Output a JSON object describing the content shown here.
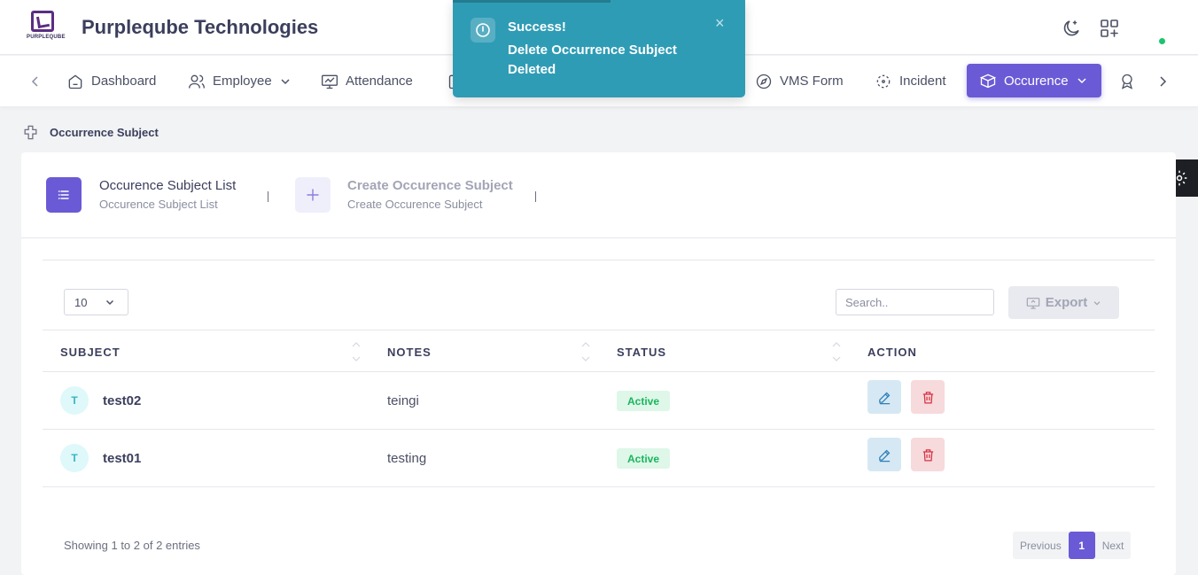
{
  "header": {
    "logo_text": "PURPLEQUBE",
    "company_name": "Purpleqube Technologies"
  },
  "toast": {
    "title": "Success!",
    "message": "Delete Occurrence Subject Deleted",
    "close": "×"
  },
  "nav": {
    "items": [
      {
        "label": "Dashboard",
        "icon": "home-icon"
      },
      {
        "label": "Employee",
        "icon": "users-icon"
      },
      {
        "label": "Attendance",
        "icon": "monitor-chart-icon"
      },
      {
        "label": "VMS Form",
        "icon": "compass-icon"
      },
      {
        "label": "Incident",
        "icon": "focus-icon"
      }
    ],
    "active": {
      "label": "Occurence",
      "icon": "box-icon"
    }
  },
  "breadcrumb": {
    "label": "Occurrence Subject"
  },
  "tabs": [
    {
      "title": "Occurence Subject List",
      "subtitle": "Occurence Subject List",
      "icon": "list-icon"
    },
    {
      "title": "Create Occurence Subject",
      "subtitle": "Create Occurence Subject",
      "icon": "plus-icon"
    }
  ],
  "table": {
    "page_length": "10",
    "search_placeholder": "Search..",
    "export_label": "Export",
    "columns": [
      "SUBJECT",
      "NOTES",
      "STATUS",
      "ACTION"
    ],
    "rows": [
      {
        "initial": "T",
        "subject": "test02",
        "notes": "teingi",
        "status": "Active"
      },
      {
        "initial": "T",
        "subject": "test01",
        "notes": "testing",
        "status": "Active"
      }
    ],
    "info": "Showing 1 to 2 of 2 entries",
    "pagination": {
      "previous": "Previous",
      "current": "1",
      "next": "Next"
    }
  },
  "colors": {
    "accent": "#6a5ad5",
    "toast": "#2f9cb5",
    "active_badge": "#1bb55d",
    "edit": "#2d7fb8",
    "delete": "#d63343"
  }
}
